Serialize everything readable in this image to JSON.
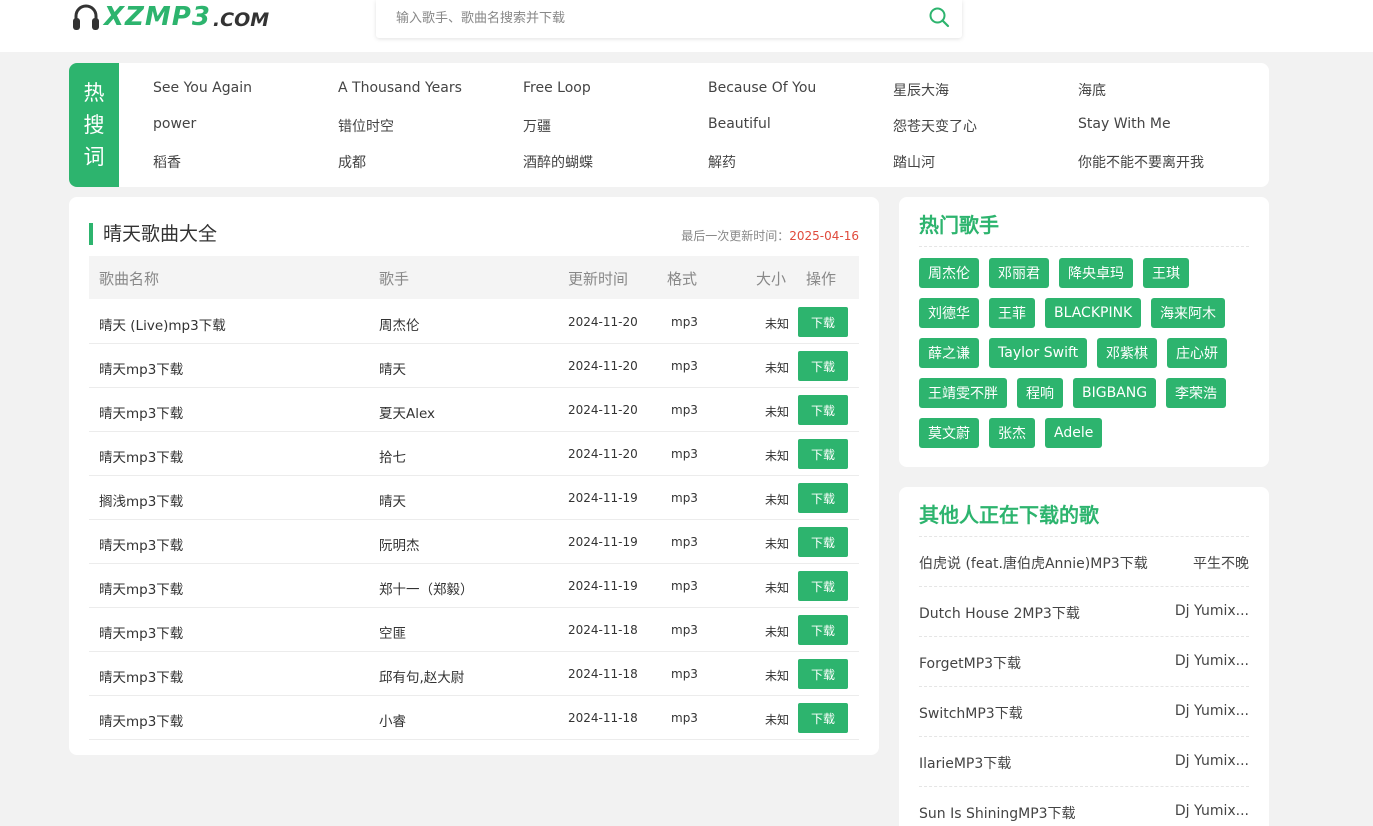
{
  "logo": {
    "text": "XZMP3",
    "suffix": ".COM"
  },
  "search": {
    "placeholder": "输入歌手、歌曲名搜索并下载"
  },
  "hot": {
    "label": [
      "热",
      "搜",
      "词"
    ],
    "items": [
      [
        "See You Again",
        "A Thousand Years",
        "Free Loop",
        "Because Of You",
        "星辰大海",
        "海底"
      ],
      [
        "power",
        "错位时空",
        "万疆",
        "Beautiful",
        "怨苍天变了心",
        "Stay With Me"
      ],
      [
        "稻香",
        "成都",
        "酒醉的蝴蝶",
        "解药",
        "踏山河",
        "你能不能不要离开我"
      ]
    ]
  },
  "main": {
    "title": "晴天歌曲大全",
    "update_label": "最后一次更新时间：",
    "update_date": "2025-04-16",
    "headers": {
      "name": "歌曲名称",
      "artist": "歌手",
      "time": "更新时间",
      "format": "格式",
      "size": "大小",
      "action": "操作"
    },
    "download_label": "下载",
    "rows": [
      {
        "name": "晴天 (Live)mp3下载",
        "artist": "周杰伦",
        "time": "2024-11-20",
        "format": "mp3",
        "size": "未知"
      },
      {
        "name": "晴天mp3下载",
        "artist": "晴天",
        "time": "2024-11-20",
        "format": "mp3",
        "size": "未知"
      },
      {
        "name": "晴天mp3下载",
        "artist": "夏天Alex",
        "time": "2024-11-20",
        "format": "mp3",
        "size": "未知"
      },
      {
        "name": "晴天mp3下载",
        "artist": "拾七",
        "time": "2024-11-20",
        "format": "mp3",
        "size": "未知"
      },
      {
        "name": "搁浅mp3下载",
        "artist": "晴天",
        "time": "2024-11-19",
        "format": "mp3",
        "size": "未知"
      },
      {
        "name": "晴天mp3下载",
        "artist": "阮明杰",
        "time": "2024-11-19",
        "format": "mp3",
        "size": "未知"
      },
      {
        "name": "晴天mp3下载",
        "artist": "郑十一（郑毅）",
        "time": "2024-11-19",
        "format": "mp3",
        "size": "未知"
      },
      {
        "name": "晴天mp3下载",
        "artist": "空匪",
        "time": "2024-11-18",
        "format": "mp3",
        "size": "未知"
      },
      {
        "name": "晴天mp3下载",
        "artist": "邱有句,赵大尉",
        "time": "2024-11-18",
        "format": "mp3",
        "size": "未知"
      },
      {
        "name": "晴天mp3下载",
        "artist": "小睿",
        "time": "2024-11-18",
        "format": "mp3",
        "size": "未知"
      }
    ]
  },
  "singers": {
    "title": "热门歌手",
    "rows": [
      [
        "周杰伦",
        "邓丽君",
        "降央卓玛",
        "王琪"
      ],
      [
        "刘德华",
        "王菲",
        "BLACKPINK",
        "海来阿木"
      ],
      [
        "薛之谦",
        "Taylor Swift",
        "邓紫棋",
        "庄心妍"
      ],
      [
        "王靖雯不胖",
        "程响",
        "BIGBANG",
        "李荣浩"
      ],
      [
        "莫文蔚",
        "张杰",
        "Adele"
      ]
    ]
  },
  "others": {
    "title": "其他人正在下载的歌",
    "items": [
      {
        "name": "伯虎说 (feat.唐伯虎Annie)MP3下载",
        "artist": "平生不晚"
      },
      {
        "name": "Dutch House 2MP3下载",
        "artist": "Dj Yumix..."
      },
      {
        "name": "ForgetMP3下载",
        "artist": "Dj Yumix..."
      },
      {
        "name": "SwitchMP3下载",
        "artist": "Dj Yumix..."
      },
      {
        "name": "IlarieMP3下载",
        "artist": "Dj Yumix..."
      },
      {
        "name": "Sun Is ShiningMP3下载",
        "artist": "Dj Yumix..."
      }
    ]
  },
  "colors": {
    "accent": "#2db46e",
    "date": "#e04b3c"
  }
}
